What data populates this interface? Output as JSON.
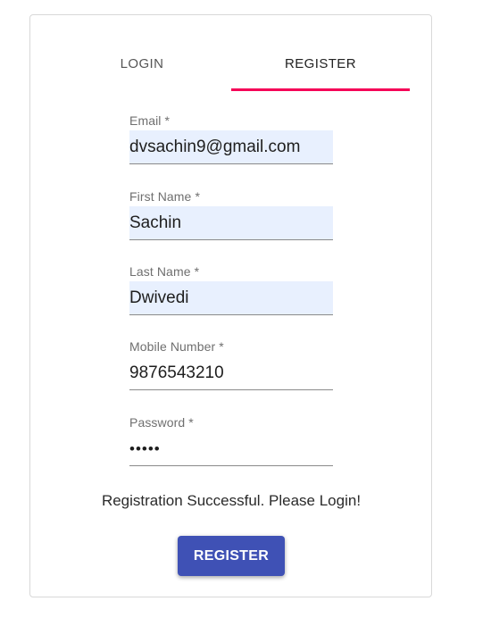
{
  "tabs": {
    "login": "LOGIN",
    "register": "REGISTER",
    "active": "register",
    "indicator_color": "#f50057"
  },
  "form": {
    "email": {
      "label": "Email *",
      "value": "dvsachin9@gmail.com"
    },
    "first_name": {
      "label": "First Name *",
      "value": "Sachin"
    },
    "last_name": {
      "label": "Last Name *",
      "value": "Dwivedi"
    },
    "mobile": {
      "label": "Mobile Number *",
      "value": "9876543210"
    },
    "password": {
      "label": "Password *",
      "value": "•••••"
    }
  },
  "message": "Registration Successful. Please Login!",
  "submit_label": "REGISTER",
  "colors": {
    "primary": "#3f51b5",
    "autofill_background": "#e8f0fe"
  }
}
